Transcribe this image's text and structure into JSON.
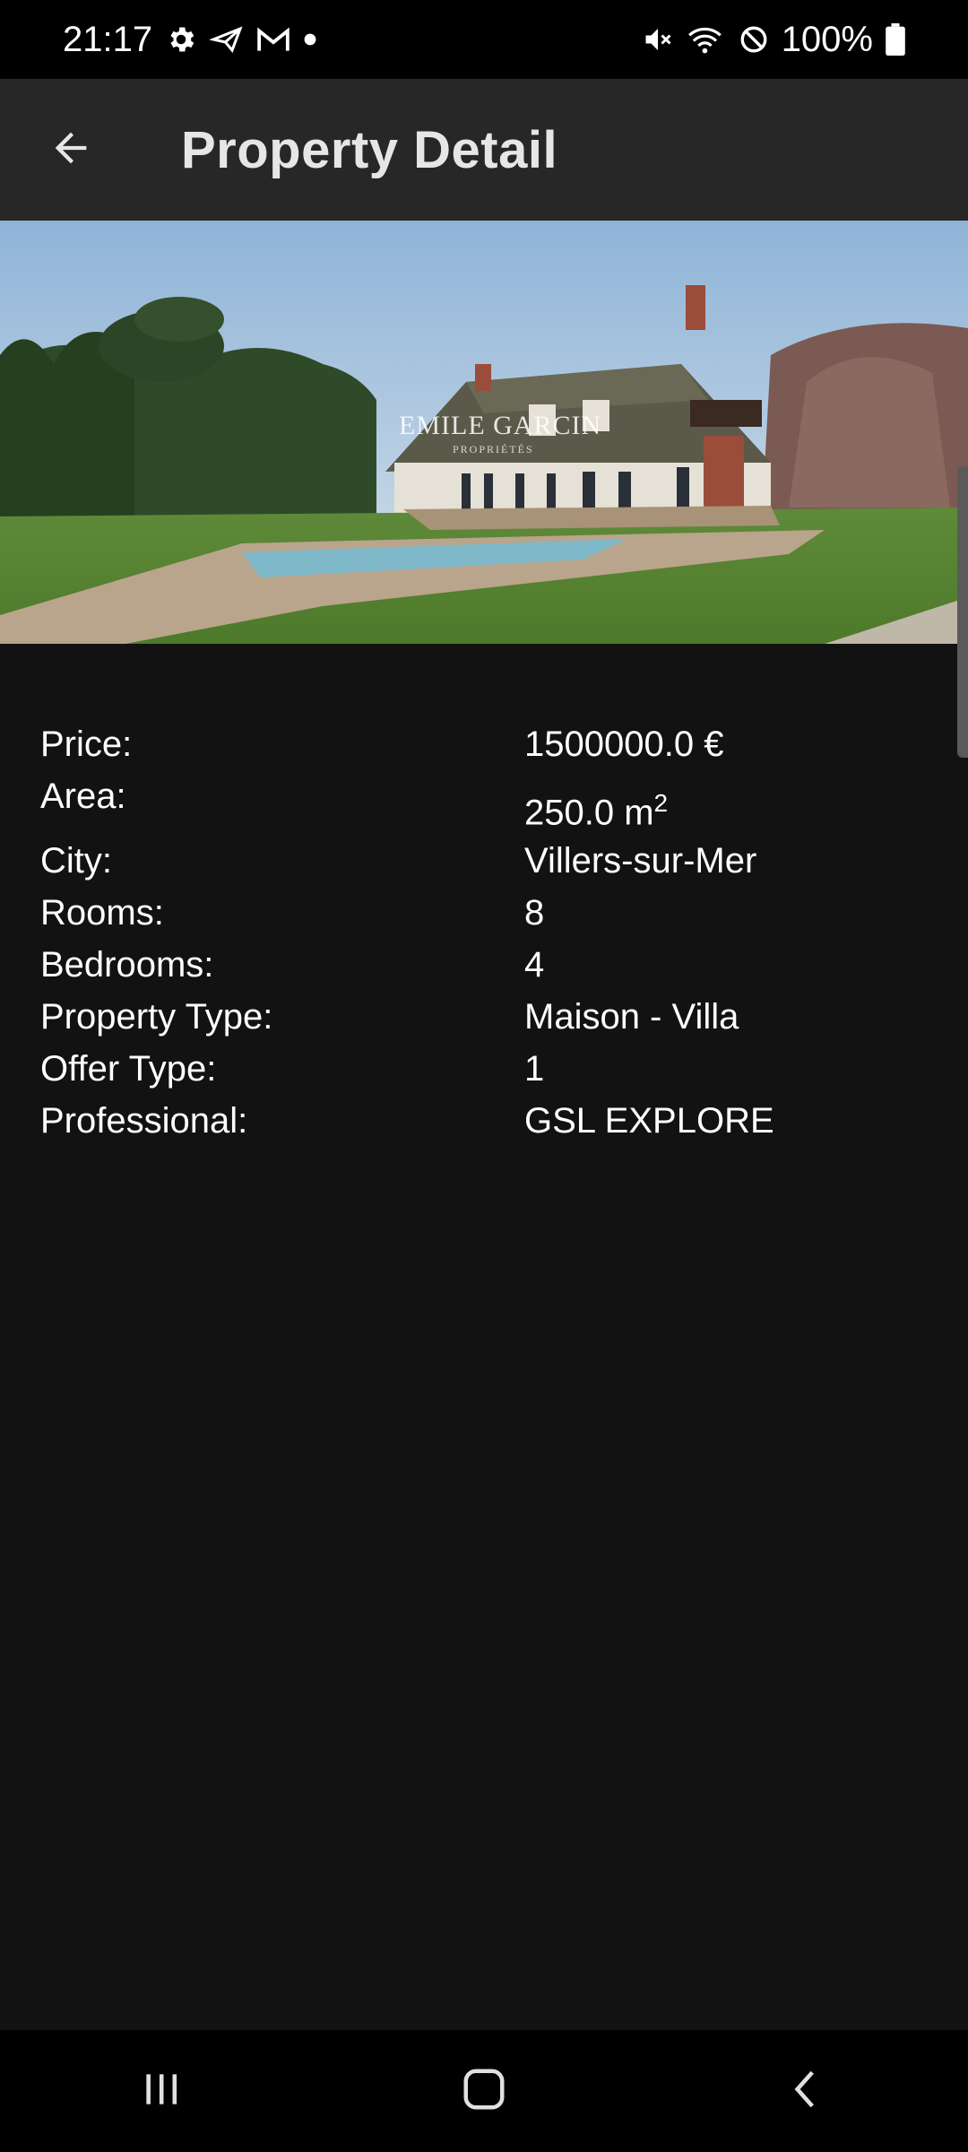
{
  "status_bar": {
    "time": "21:17",
    "battery": "100%",
    "icons_left": [
      "settings-icon",
      "send-icon",
      "gmail-icon",
      "dot-icon"
    ],
    "icons_right": [
      "mute-icon",
      "wifi-icon",
      "dnd-icon",
      "battery-icon"
    ]
  },
  "app_bar": {
    "title": "Property Detail",
    "back_icon": "arrow-back-icon"
  },
  "hero": {
    "watermark": "EMILE GARCIN",
    "watermark_sub": "PROPRIÉTÉS"
  },
  "details": [
    {
      "label": "Price:",
      "value": "1500000.0 €"
    },
    {
      "label": "Area:",
      "value": "250.0 m",
      "sup": "2"
    },
    {
      "label": "City:",
      "value": "Villers-sur-Mer"
    },
    {
      "label": "Rooms:",
      "value": "8"
    },
    {
      "label": "Bedrooms:",
      "value": "4"
    },
    {
      "label": "Property Type:",
      "value": "Maison - Villa"
    },
    {
      "label": "Offer Type:",
      "value": "1"
    },
    {
      "label": "Professional:",
      "value": "GSL EXPLORE"
    }
  ],
  "nav_bar": {
    "items": [
      "recent-apps-icon",
      "home-icon",
      "back-icon"
    ]
  },
  "colors": {
    "background": "#121212",
    "app_bar": "#272727",
    "system_bars": "#000000",
    "text": "#ffffff"
  }
}
